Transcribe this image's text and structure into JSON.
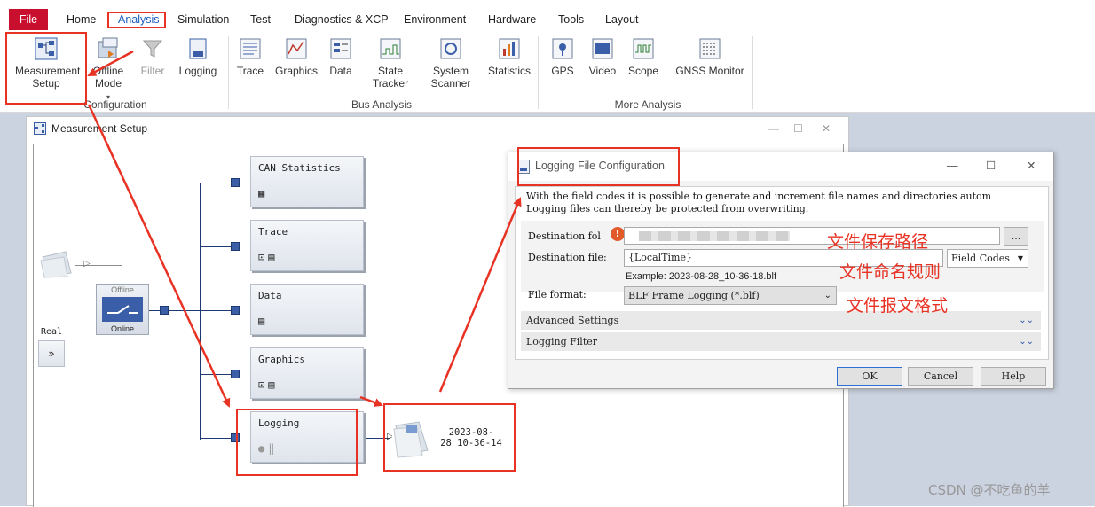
{
  "menu": {
    "file": "File",
    "tabs": [
      "Home",
      "Analysis",
      "Simulation",
      "Test",
      "Diagnostics & XCP",
      "Environment",
      "Hardware",
      "Tools",
      "Layout"
    ]
  },
  "ribbon": {
    "measurement_setup": "Measurement Setup",
    "offline_mode": "Offline Mode",
    "filter": "Filter",
    "logging": "Logging",
    "trace": "Trace",
    "graphics": "Graphics",
    "data": "Data",
    "state_tracker": "State Tracker",
    "system_scanner": "System Scanner",
    "statistics": "Statistics",
    "gps": "GPS",
    "video": "Video",
    "scope": "Scope",
    "gnss_monitor": "GNSS Monitor",
    "groups": {
      "configuration": "Configuration",
      "bus_analysis": "Bus Analysis",
      "more_analysis": "More Analysis"
    }
  },
  "measurement_window": {
    "title": "Measurement Setup",
    "blocks": {
      "can_statistics": "CAN Statistics",
      "trace": "Trace",
      "data": "Data",
      "graphics": "Graphics",
      "logging": "Logging"
    },
    "offline_label": "Offline",
    "online_label": "Online",
    "real_label": "Real",
    "log_file_name": "2023-08-28_10-36-14"
  },
  "dialog": {
    "title": "Logging File Configuration",
    "info_line1": "With the field codes it is possible to generate and increment file names and directories autom",
    "info_line2": "Logging files can thereby be protected from overwriting.",
    "destination_folder_label": "Destination fol",
    "destination_file_label": "Destination file:",
    "destination_file_value": "{LocalTime}",
    "field_codes": "Field Codes",
    "example": "Example: 2023-08-28_10-36-18.blf",
    "file_format_label": "File format:",
    "file_format_value": "BLF Frame Logging (*.blf)",
    "advanced_settings": "Advanced Settings",
    "logging_filter": "Logging Filter",
    "ok": "OK",
    "cancel": "Cancel",
    "help": "Help",
    "browse": "..."
  },
  "annotations": {
    "save_path": "文件保存路径",
    "naming_rule": "文件命名规则",
    "message_format": "文件报文格式"
  },
  "watermark": "CSDN @不吃鱼的羊",
  "colors": {
    "accent_red": "#e83224",
    "file_tab": "#c8102e",
    "node_blue": "#3a5fa8"
  }
}
